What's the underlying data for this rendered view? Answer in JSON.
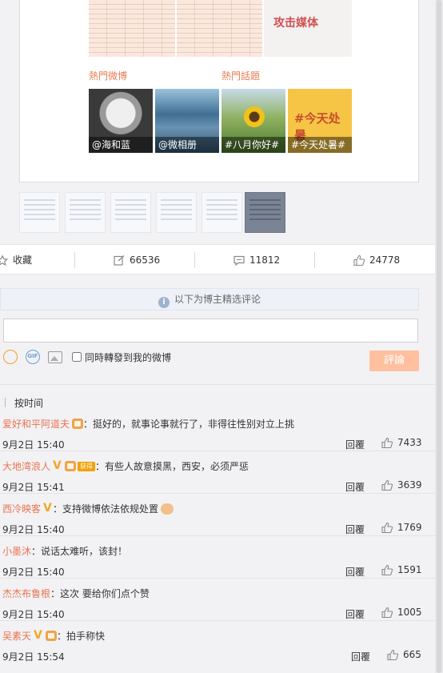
{
  "card": {
    "doc_caption": "攻击媒体",
    "section_hot_weibo": "熱門微博",
    "section_hot_topic": "熱門話題",
    "tiles": [
      {
        "caption": "@海和蓝"
      },
      {
        "caption": "@微相册"
      },
      {
        "caption": "#八月你好#"
      },
      {
        "caption": "#今天处暑#"
      }
    ],
    "tile4_text": "#今天处暑"
  },
  "actions": {
    "favorite": "收藏",
    "repost_count": "66536",
    "comment_count": "11812",
    "like_count": "24778"
  },
  "comments_panel": {
    "notice": "以下为博主精选评论",
    "input_placeholder": "",
    "sync_label": "同時轉發到我的微博",
    "submit_label": "評論",
    "sort_label": "按时间",
    "tag_label": "获得"
  },
  "comments": [
    {
      "user": "爱好和平阿道夫",
      "text": "：挺好的，就事论事就行了，非得往性别对立上挑",
      "time": "9月2日 15:40",
      "reply": "回覆",
      "likes": "7433"
    },
    {
      "user": "大地湾浪人",
      "text": "：有些人故意摸黑，西安，必须严惩",
      "time": "9月2日 15:41",
      "reply": "回覆",
      "likes": "3639"
    },
    {
      "user": "西冷映客",
      "text": "：支持微博依法依规处置",
      "time": "9月2日 15:40",
      "reply": "回覆",
      "likes": "1769"
    },
    {
      "user": "小墨沐",
      "text": "：说话太难听，该封！",
      "time": "9月2日 15:40",
      "reply": "回覆",
      "likes": "1591"
    },
    {
      "user": "杰杰布鲁根",
      "text": "：这次 要给你们点个赞",
      "time": "9月2日 15:40",
      "reply": "回覆",
      "likes": "1005"
    },
    {
      "user": "吴素天",
      "text": "：拍手称快",
      "time": "9月2日 15:54",
      "reply": "回覆",
      "likes": "665"
    }
  ]
}
